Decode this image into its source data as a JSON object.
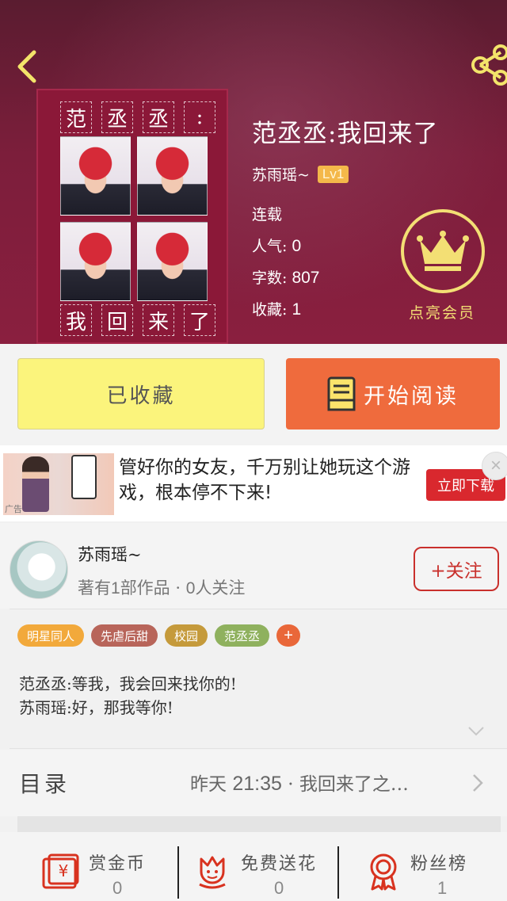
{
  "header": {
    "book_title": "范丞丞:我回来了",
    "author": "苏雨瑶~",
    "level": "Lv1",
    "status": "连载",
    "popularity_label": "人气:",
    "popularity_value": "0",
    "word_count_label": "字数:",
    "word_count_value": "807",
    "favorites_label": "收藏:",
    "favorites_value": "1",
    "vip_label": "点亮会员",
    "icons": {
      "back": "back-arrow-icon",
      "share": "share-icon",
      "vip": "crown-icon"
    }
  },
  "cover": {
    "top_chars": [
      "范",
      "丞",
      "丞",
      ":"
    ],
    "bottom_chars": [
      "我",
      "回",
      "来",
      "了"
    ]
  },
  "actions": {
    "collected_label": "已收藏",
    "read_label": "开始阅读"
  },
  "ad": {
    "text": "管好你的女友，千万别让她玩这个游戏，根本停不下来!",
    "cta": "立即下载",
    "tag": "广告",
    "close": "×"
  },
  "author_section": {
    "name": "苏雨瑶~",
    "works_prefix": "著有",
    "works_count": "1",
    "works_suffix": "部作品",
    "sep": "·",
    "followers_count": "0",
    "followers_suffix": "人关注",
    "follow_label": "+关注"
  },
  "tags": [
    {
      "label": "明星同人",
      "color": "#f2a93b"
    },
    {
      "label": "先虐后甜",
      "color": "#b8655a"
    },
    {
      "label": "校园",
      "color": "#c59a3b"
    },
    {
      "label": "范丞丞",
      "color": "#8fb15e"
    }
  ],
  "tag_add": "+",
  "description": "范丞丞:等我，我会回来找你的!\n苏雨瑶:好，那我等你!",
  "toc": {
    "label": "目录",
    "day": "昨天",
    "time": "21:35",
    "sep": "·",
    "latest": "我回来了之…"
  },
  "bottom": {
    "reward_label": "赏金币",
    "reward_value": "0",
    "flower_label": "免费送花",
    "flower_value": "0",
    "fans_label": "粉丝榜",
    "fans_value": "1"
  },
  "colors": {
    "header_bg": "#7c1e3b",
    "accent_orange": "#ef6b3d",
    "collected_yellow": "#fbf47c",
    "follow_red": "#c9302c",
    "gold": "#f3df74"
  }
}
